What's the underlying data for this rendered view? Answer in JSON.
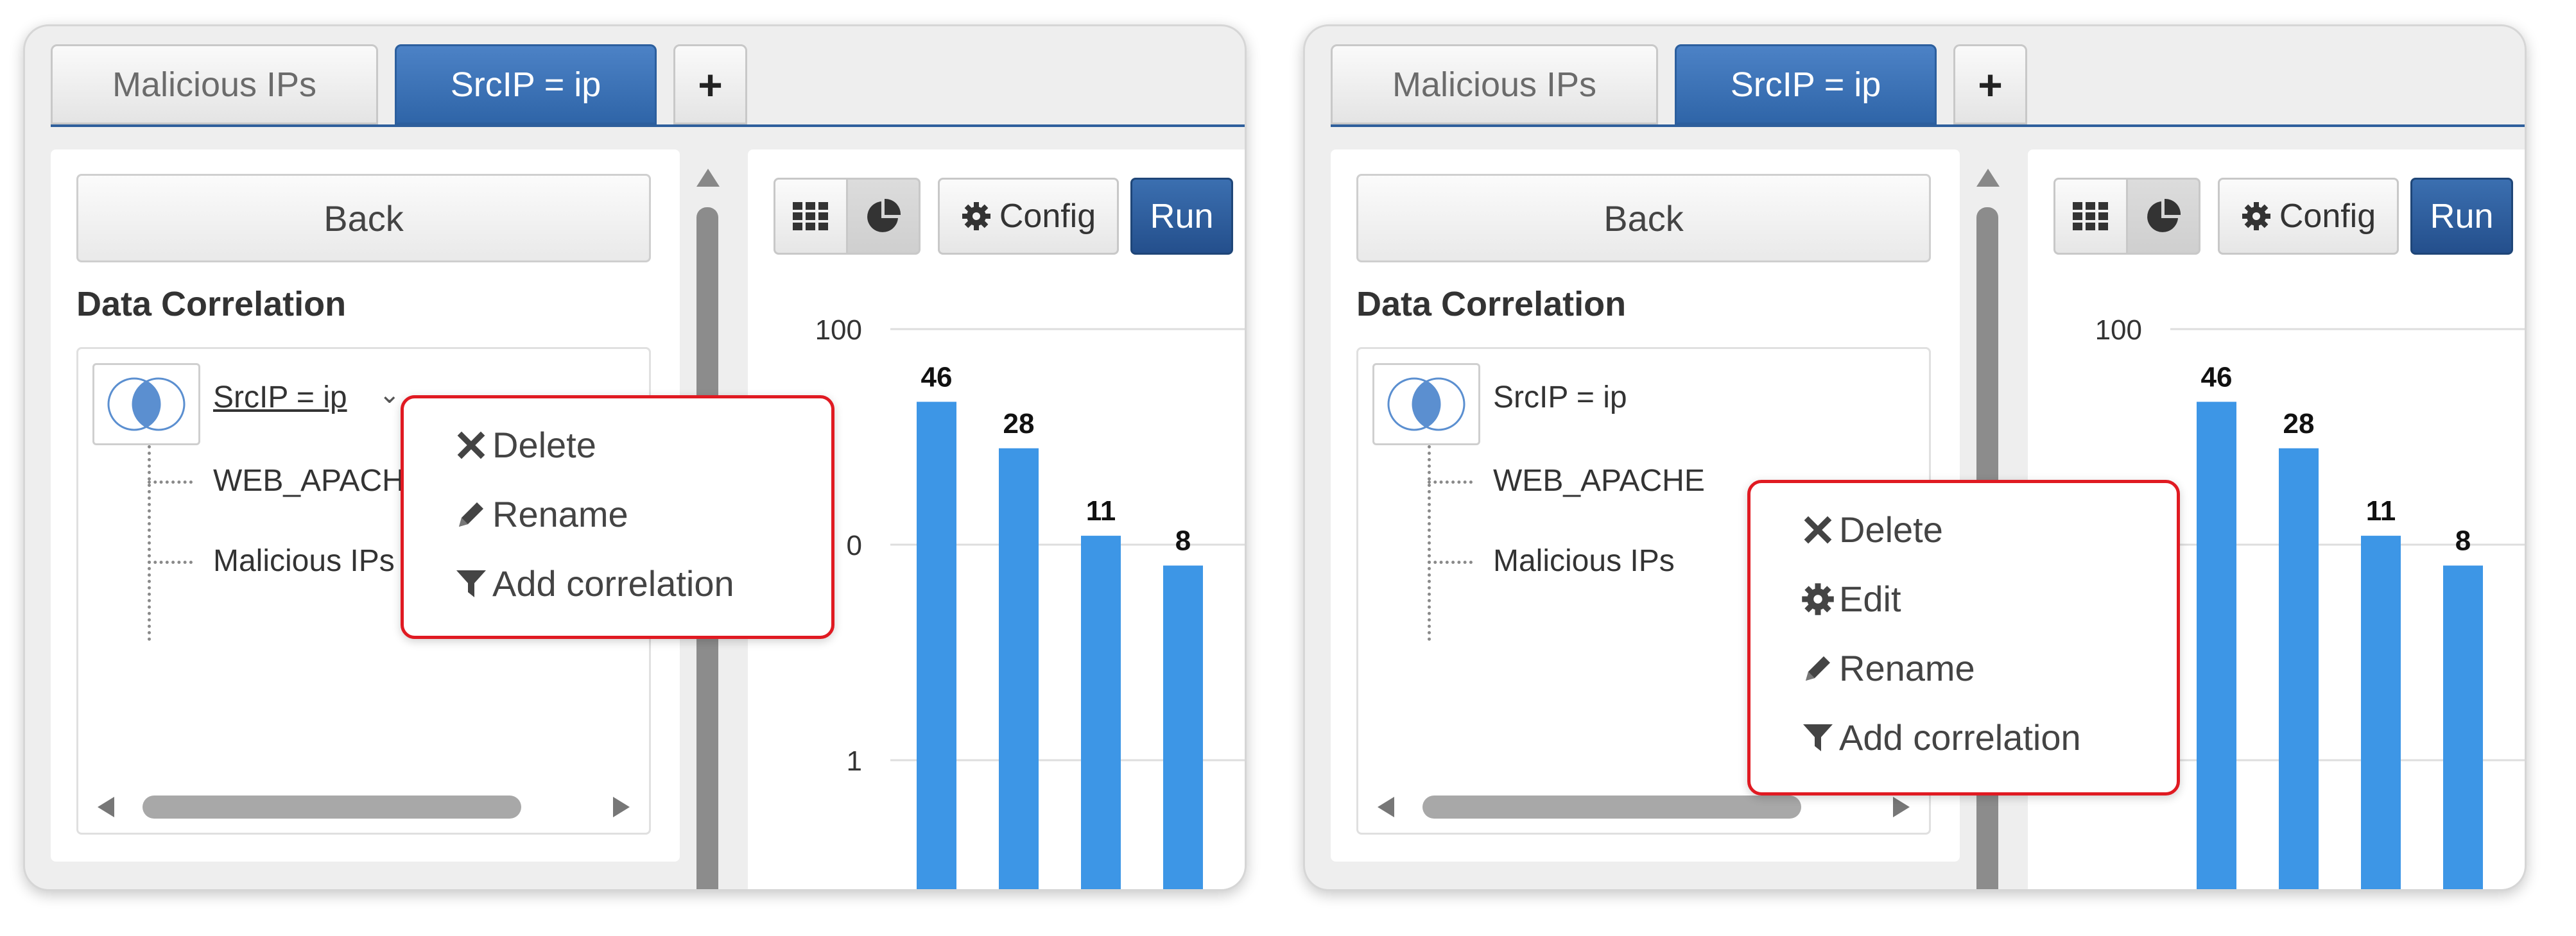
{
  "panels": [
    {
      "tabs": {
        "inactive": "Malicious IPs",
        "active": "SrcIP = ip",
        "add": "+"
      },
      "back_label": "Back",
      "section_title": "Data Correlation",
      "tree": {
        "root": "SrcIP = ip",
        "children": [
          "WEB_APACHE",
          "Malicious IPs"
        ]
      },
      "toolbar": {
        "config_label": "Config",
        "run_label": "Run"
      },
      "context_menu": [
        {
          "icon": "close-icon",
          "label": "Delete"
        },
        {
          "icon": "pencil-icon",
          "label": "Rename"
        },
        {
          "icon": "filter-icon",
          "label": "Add correlation"
        }
      ]
    },
    {
      "tabs": {
        "inactive": "Malicious IPs",
        "active": "SrcIP = ip",
        "add": "+"
      },
      "back_label": "Back",
      "section_title": "Data Correlation",
      "tree": {
        "root": "SrcIP = ip",
        "children": [
          "WEB_APACHE",
          "Malicious IPs"
        ]
      },
      "toolbar": {
        "config_label": "Config",
        "run_label": "Run"
      },
      "context_menu": [
        {
          "icon": "close-icon",
          "label": "Delete"
        },
        {
          "icon": "gear-icon",
          "label": "Edit"
        },
        {
          "icon": "pencil-icon",
          "label": "Rename"
        },
        {
          "icon": "filter-icon",
          "label": "Add correlation"
        }
      ]
    }
  ],
  "chart_data": [
    {
      "type": "bar",
      "scale": "log",
      "values": [
        46,
        28,
        11,
        8
      ],
      "data_labels": [
        "46",
        "28",
        "11",
        "8"
      ],
      "y_ticks": [
        "100",
        "0",
        "1"
      ],
      "grid": true,
      "bar_color": "#3d96e6"
    },
    {
      "type": "bar",
      "scale": "log",
      "values": [
        46,
        28,
        11,
        8
      ],
      "data_labels": [
        "46",
        "28",
        "11",
        "8"
      ],
      "y_ticks": [
        "100"
      ],
      "grid": true,
      "bar_color": "#3d96e6"
    }
  ],
  "colors": {
    "accent": "#2f65a8",
    "menu_border": "#e01a22",
    "bar": "#3d96e6"
  }
}
